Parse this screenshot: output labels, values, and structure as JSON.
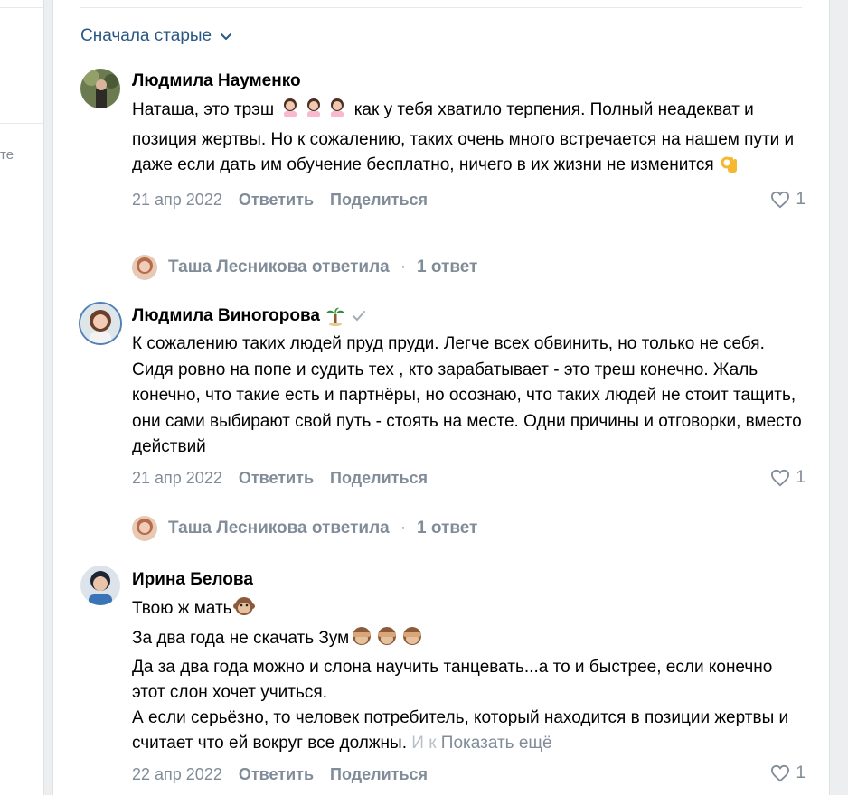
{
  "left_fragment": "те",
  "sort": {
    "label": "Сначала старые"
  },
  "comments": [
    {
      "author": "Людмила Науменко",
      "text_parts": [
        "Наташа, это трэш",
        "как у тебя хватило терпения. Полный неадекват и позиция жертвы. Но к сожалению, таких очень много встречается на нашем пути и даже если дать им обучение бесплатно, ничего в их жизни не изменится"
      ],
      "date": "21 апр 2022",
      "reply_label": "Ответить",
      "share_label": "Поделиться",
      "likes": "1",
      "thread": {
        "text": "Таша Лесникова ответила",
        "sep": "·",
        "count": "1 ответ"
      }
    },
    {
      "author": "Людмила Виногорова",
      "text": "К сожалению таких людей пруд пруди. Легче всех обвинить, но только не себя. Сидя ровно на попе и судить тех , кто зарабатывает - это треш конечно. Жаль конечно, что такие есть и партнёры, но осознаю, что таких людей не стоит тащить, они сами выбирают свой путь - стоять на месте. Одни причины и отговорки, вместо действий",
      "date": "21 апр 2022",
      "reply_label": "Ответить",
      "share_label": "Поделиться",
      "likes": "1",
      "thread": {
        "text": "Таша Лесникова ответила",
        "sep": "·",
        "count": "1 ответ"
      }
    },
    {
      "author": "Ирина Белова",
      "line1": "Твою ж мать",
      "line2": "За два года не скачать Зум",
      "line3": "Да за два года можно и слона научить танцевать...а то и быстрее, если конечно этот слон хочет учиться.",
      "line4": "А если серьёзно, то человек потребитель, который находится в позиции жертвы и считает что ей вокруг все должны.",
      "fade": "И к",
      "show_more": "Показать ещё",
      "date": "22 апр 2022",
      "reply_label": "Ответить",
      "share_label": "Поделиться",
      "likes": "1"
    }
  ],
  "colors": {
    "link": "#2a5885",
    "meta": "#818c99",
    "bg": "#edeef0"
  }
}
